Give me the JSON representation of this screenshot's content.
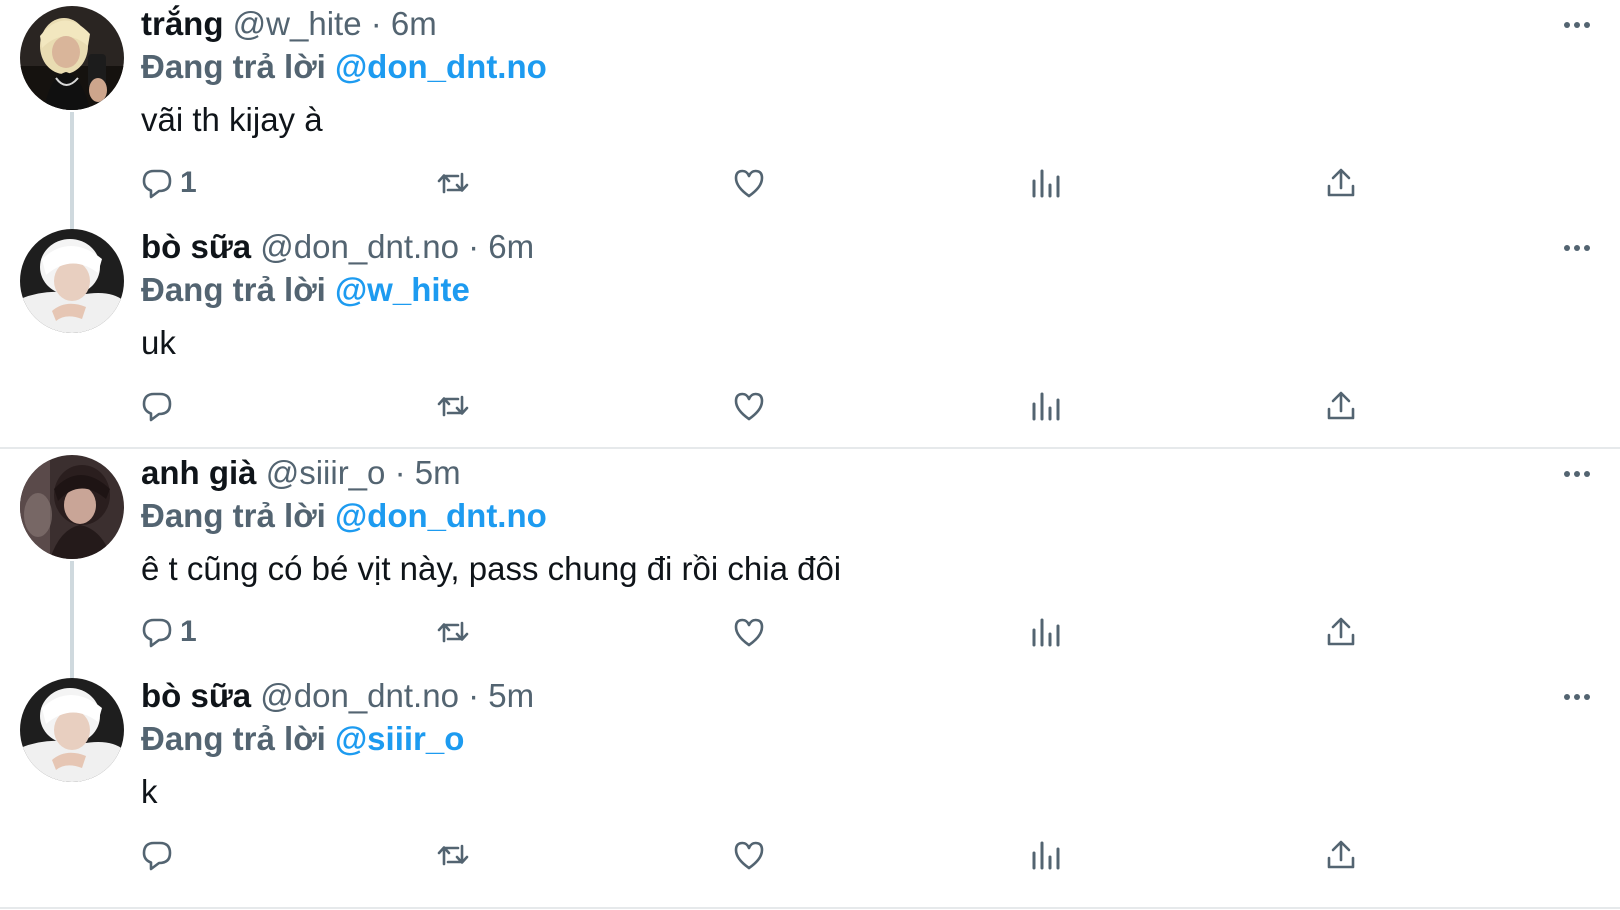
{
  "threads": [
    {
      "tweets": [
        {
          "name": "trắng",
          "handle": "@w_hite",
          "separator": "·",
          "time": "6m",
          "replying_label": "Đang trả lời",
          "replying_to": "@don_dnt.no",
          "text": "vãi th kijay à",
          "reply_count": "1",
          "avatar_icon": "avatar-blonde"
        },
        {
          "name": "bò sữa",
          "handle": "@don_dnt.no",
          "separator": "·",
          "time": "6m",
          "replying_label": "Đang trả lời",
          "replying_to": "@w_hite",
          "text": "uk",
          "reply_count": "",
          "avatar_icon": "avatar-white-hair"
        }
      ]
    },
    {
      "tweets": [
        {
          "name": "anh già",
          "handle": "@siiir_o",
          "separator": "·",
          "time": "5m",
          "replying_label": "Đang trả lời",
          "replying_to": "@don_dnt.no",
          "text": "ê t cũng có bé vịt này, pass chung đi rồi chia đôi",
          "reply_count": "1",
          "avatar_icon": "avatar-dark-hair"
        },
        {
          "name": "bò sữa",
          "handle": "@don_dnt.no",
          "separator": "·",
          "time": "5m",
          "replying_label": "Đang trả lời",
          "replying_to": "@siiir_o",
          "text": "k",
          "reply_count": "",
          "avatar_icon": "avatar-white-hair"
        }
      ]
    }
  ],
  "colors": {
    "text_primary": "#0f1419",
    "text_secondary": "#536471",
    "mention": "#1d9bf0",
    "divider": "#e6e9eb",
    "thread_line": "#cfd9de"
  },
  "icons": {
    "reply": "reply-bubble-icon",
    "retweet": "retweet-icon",
    "like": "heart-icon",
    "views": "views-bar-chart-icon",
    "share": "share-upload-icon",
    "more": "more-dots-icon"
  }
}
